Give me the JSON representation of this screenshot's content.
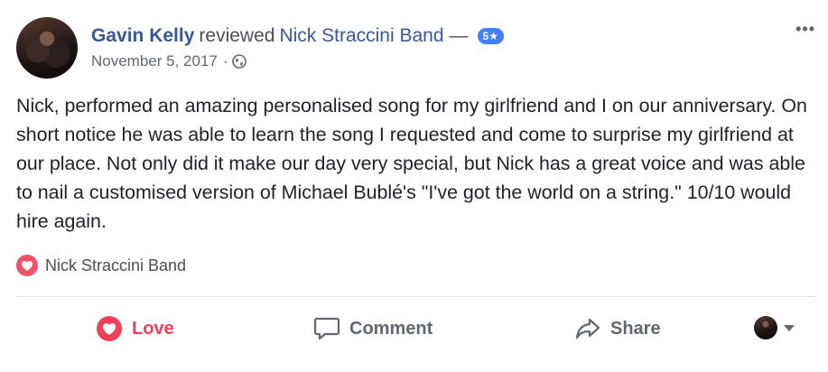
{
  "post": {
    "author": "Gavin Kelly",
    "action_text": "reviewed",
    "page_name": "Nick Straccini Band",
    "dash": "—",
    "rating": "5★",
    "date": "November 5, 2017",
    "date_separator": "·",
    "privacy_icon": "globe-icon",
    "more_label": "•••",
    "body": "Nick, performed an amazing personalised song for my girlfriend and I on our anniversary. On short notice he was able to learn the song I requested and come to surprise my girlfriend at our place. Not only did it make our day very special, but Nick has a great voice and was able to nail a customised version of Michael Bublé's \"I've got the world on a string.\" 10/10 would hire again.",
    "tagged_page": "Nick Straccini Band"
  },
  "actions": {
    "love": "Love",
    "comment": "Comment",
    "share": "Share"
  },
  "colors": {
    "link": "#365899",
    "love": "#f33e58",
    "badge": "#4080ff"
  }
}
